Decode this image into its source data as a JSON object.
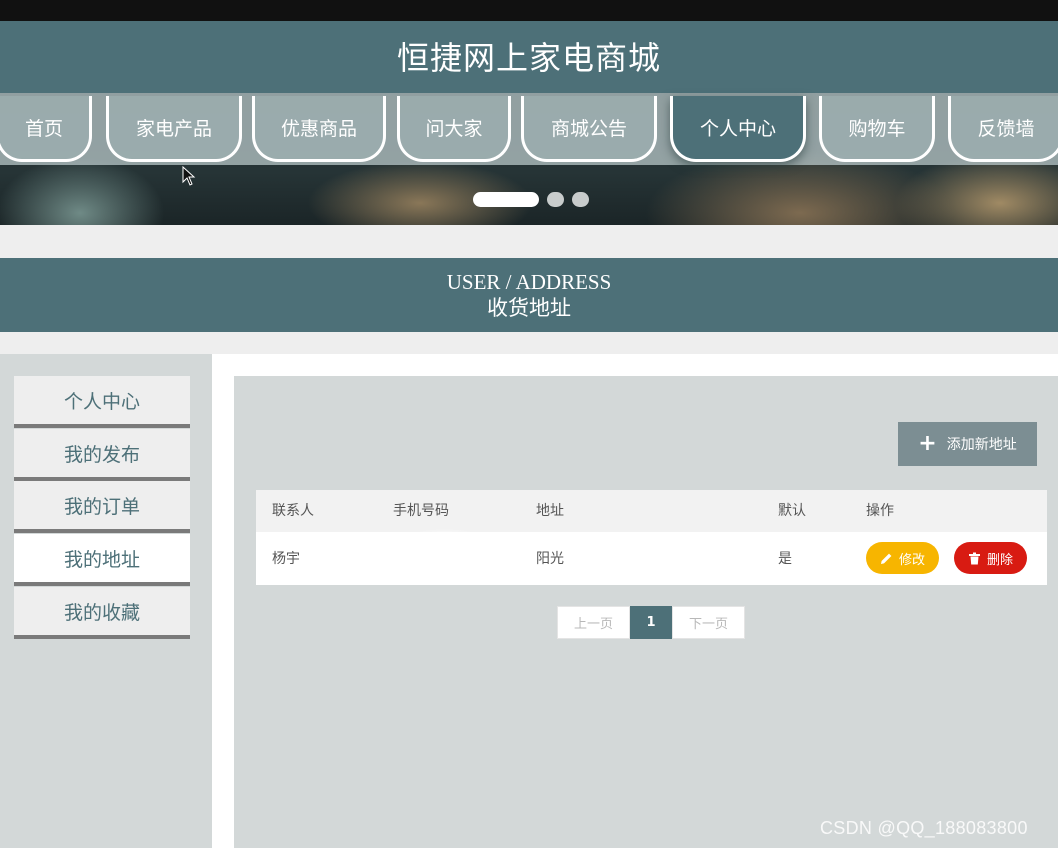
{
  "site": {
    "title": "恒捷网上家电商城"
  },
  "nav": {
    "items": [
      {
        "label": "首页"
      },
      {
        "label": "家电产品"
      },
      {
        "label": "优惠商品"
      },
      {
        "label": "问大家"
      },
      {
        "label": "商城公告"
      },
      {
        "label": "个人中心",
        "active": true
      },
      {
        "label": "购物车"
      },
      {
        "label": "反馈墙"
      }
    ]
  },
  "banner": {
    "slides": 3,
    "active_slide": 1
  },
  "section": {
    "title_en": "USER / ADDRESS",
    "title_cn": "收货地址"
  },
  "sidebar": {
    "items": [
      {
        "label": "个人中心"
      },
      {
        "label": "我的发布"
      },
      {
        "label": "我的订单"
      },
      {
        "label": "我的地址",
        "active": true
      },
      {
        "label": "我的收藏"
      }
    ]
  },
  "toolbar": {
    "add_label": "添加新地址",
    "add_icon": "plus-icon"
  },
  "table": {
    "headers": [
      "联系人",
      "手机号码",
      "地址",
      "默认",
      "操作"
    ],
    "rows": [
      {
        "contact": "杨宇",
        "phone": "",
        "address": "阳光",
        "default": "是",
        "edit_label": "修改",
        "delete_label": "删除"
      }
    ]
  },
  "pagination": {
    "prev": "上一页",
    "current": "1",
    "next": "下一页"
  },
  "watermark": "CSDN @QQ_188083800",
  "colors": {
    "primary": "#4d7078",
    "edit": "#f7b500",
    "delete": "#d81b12",
    "sidebar_bg": "#d3d8d8"
  }
}
